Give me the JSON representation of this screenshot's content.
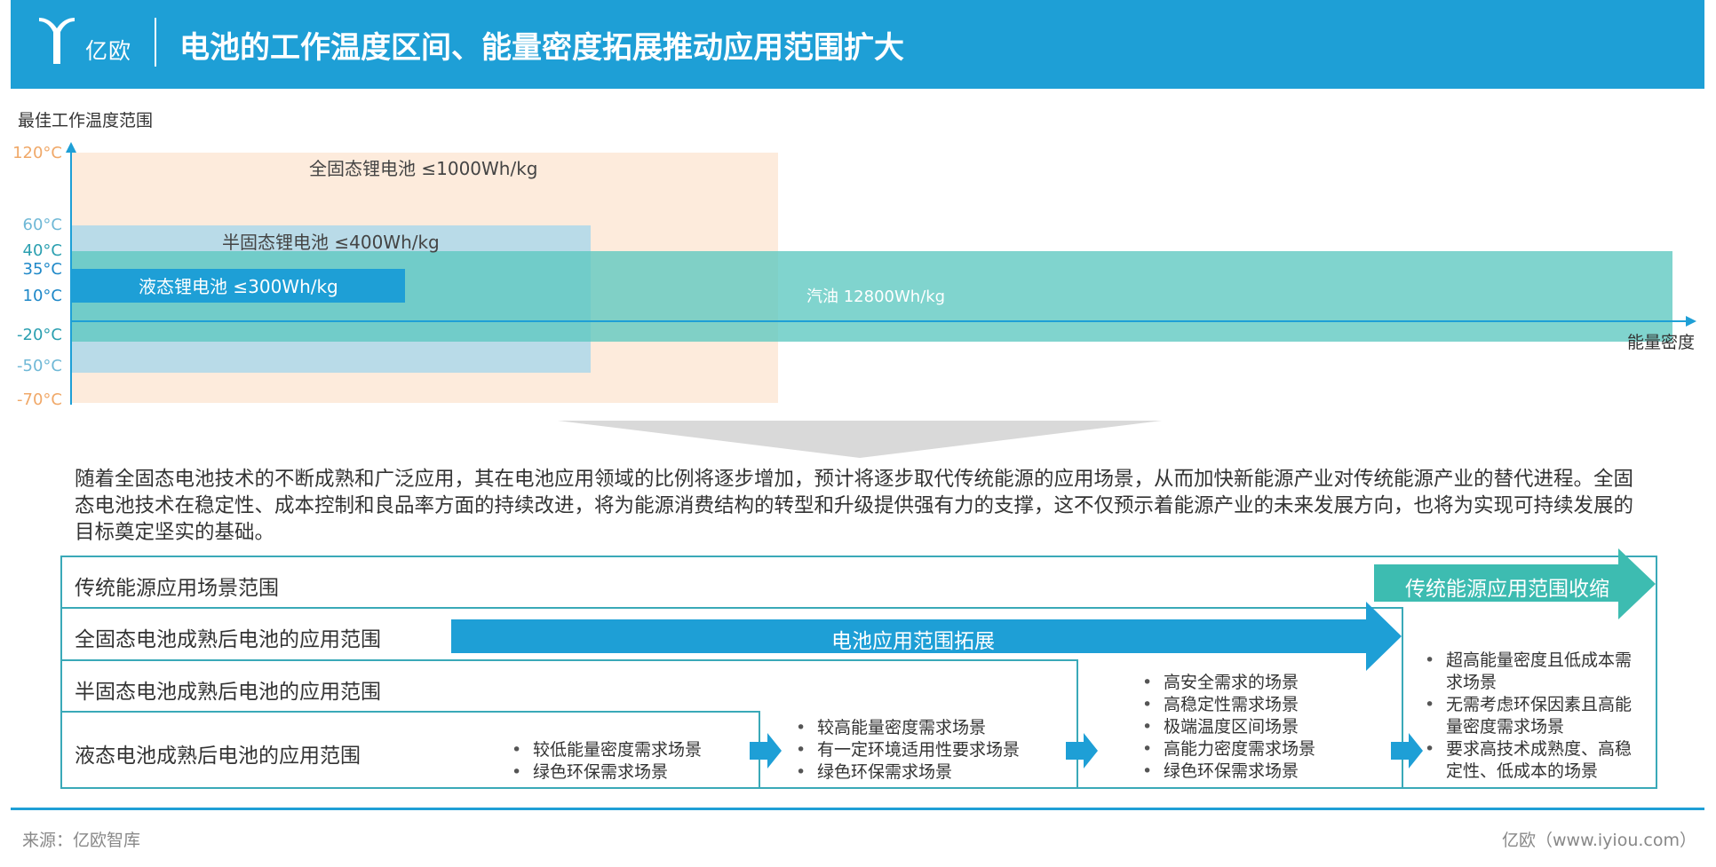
{
  "header": {
    "logo_text": "亿欧",
    "title": "电池的工作温度区间、能量密度拓展推动应用范围扩大"
  },
  "chart": {
    "y_axis_title": "最佳工作温度范围",
    "x_axis_title": "能量密度",
    "y_ticks": [
      {
        "label": "120°C",
        "color": "#f0a868"
      },
      {
        "label": "60°C",
        "color": "#6fb8d6"
      },
      {
        "label": "40°C",
        "color": "#2a9fb0"
      },
      {
        "label": "35°C",
        "color": "#1e88c8"
      },
      {
        "label": "10°C",
        "color": "#1e88c8"
      },
      {
        "label": "-20°C",
        "color": "#2a9fb0"
      },
      {
        "label": "-50°C",
        "color": "#6fb8d6"
      },
      {
        "label": "-70°C",
        "color": "#f0a868"
      }
    ],
    "series": [
      {
        "name": "全固态锂电池 ≤1000Wh/kg",
        "color": "#fdebdc"
      },
      {
        "name": "半固态锂电池 ≤400Wh/kg",
        "color": "#b9dbe8"
      },
      {
        "name": "汽油 12800Wh/kg",
        "color": "#5cc8c0"
      },
      {
        "name": "液态锂电池 ≤300Wh/kg",
        "color": "#1e9fd6"
      }
    ]
  },
  "paragraph": "随着全固态电池技术的不断成熟和广泛应用，其在电池应用领域的比例将逐步增加，预计将逐步取代传统能源的应用场景，从而加快新能源产业对传统能源产业的替代进程。全固态电池技术在稳定性、成本控制和良品率方面的持续改进，将为能源消费结构的转型和升级提供强有力的支撑，这不仅预示着能源产业的未来发展方向，也将为实现可持续发展的目标奠定坚实的基础。",
  "table": {
    "rows": [
      "传统能源应用场景范围",
      "全固态电池成熟后电池的应用范围",
      "半固态电池成熟后电池的应用范围",
      "液态电池成熟后电池的应用范围"
    ],
    "arrow_expand": "电池应用范围拓展",
    "arrow_shrink": "传统能源应用范围收缩",
    "col1": [
      "较低能量密度需求场景",
      "绿色环保需求场景"
    ],
    "col2": [
      "较高能量密度需求场景",
      "有一定环境适用性要求场景",
      "绿色环保需求场景"
    ],
    "col3": [
      "高安全需求的场景",
      "高稳定性需求场景",
      "极端温度区间场景",
      "高能力密度需求场景",
      "绿色环保需求场景"
    ],
    "col4": [
      "超高能量密度且低成本需求场景",
      "无需考虑环保因素且高能量密度需求场景",
      "要求高技术成熟度、高稳定性、低成本的场景"
    ]
  },
  "footer": {
    "source": "来源：亿欧智库",
    "site": "亿欧（www.iyiou.com）"
  }
}
